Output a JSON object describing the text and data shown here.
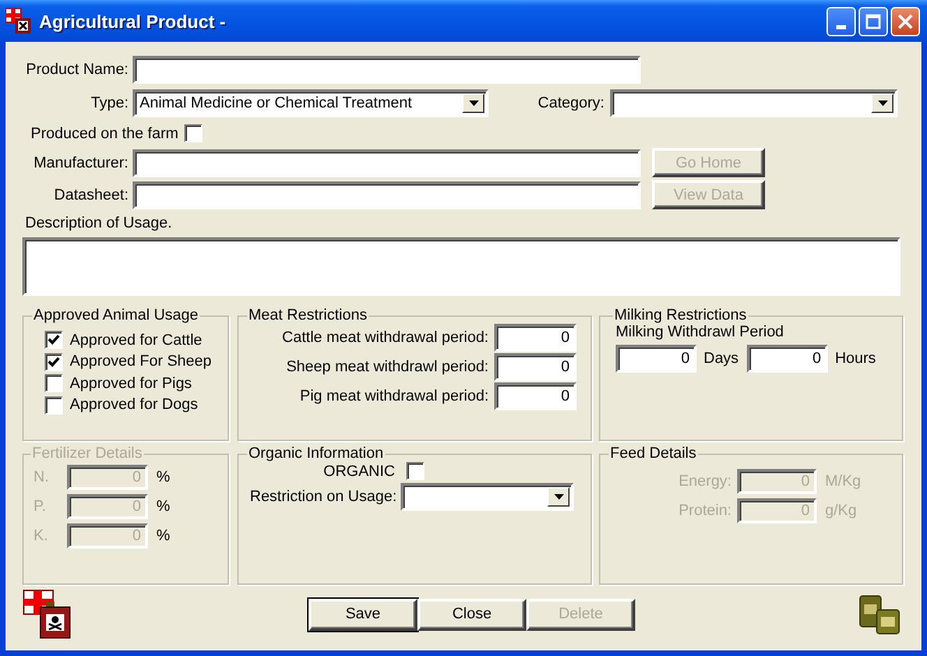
{
  "window": {
    "title": "Agricultural Product -"
  },
  "product_name": {
    "label": "Product Name:"
  },
  "type": {
    "label": "Type:",
    "value": "Animal Medicine or Chemical Treatment"
  },
  "category": {
    "label": "Category:"
  },
  "produced_on_farm": {
    "label": "Produced on the farm",
    "checked": false
  },
  "manufacturer": {
    "label": "Manufacturer:"
  },
  "datasheet": {
    "label": "Datasheet:"
  },
  "side_buttons": [
    {
      "label": "Go Home",
      "disabled": true
    },
    {
      "label": "View Data",
      "disabled": true
    }
  ],
  "description": {
    "label": "Description of Usage."
  },
  "approved_animal_usage": {
    "title": "Approved Animal Usage",
    "items": [
      {
        "label": "Approved for Cattle",
        "checked": true
      },
      {
        "label": "Approved For Sheep",
        "checked": true
      },
      {
        "label": "Approved for Pigs",
        "checked": false
      },
      {
        "label": "Approved for Dogs",
        "checked": false
      }
    ]
  },
  "meat_restrictions": {
    "title": "Meat Restrictions",
    "rows": [
      {
        "label": "Cattle meat withdrawal period:",
        "value": "0"
      },
      {
        "label": "Sheep meat withdrawl period:",
        "value": "0"
      },
      {
        "label": "Pig meat withdrawal period:",
        "value": "0"
      }
    ]
  },
  "milking_restrictions": {
    "title": "Milking Restrictions",
    "subtitle": "Milking Withdrawl Period",
    "fields": [
      {
        "value": "0",
        "unit": "Days"
      },
      {
        "value": "0",
        "unit": "Hours"
      }
    ]
  },
  "fertilizer_details": {
    "title": "Fertilizer Details",
    "disabled": true,
    "rows": [
      {
        "label": "N.",
        "value": "0",
        "unit": "%",
        "disabled": true,
        "unit_disabled": false
      },
      {
        "label": "P.",
        "value": "0",
        "unit": "%",
        "disabled": true,
        "unit_disabled": false
      },
      {
        "label": "K.",
        "value": "0",
        "unit": "%",
        "disabled": true,
        "unit_disabled": false
      }
    ]
  },
  "organic_information": {
    "title": "Organic Information",
    "organic": {
      "label": "ORGANIC",
      "checked": false
    },
    "restriction": {
      "label": "Restriction on Usage:"
    }
  },
  "feed_details": {
    "title": "Feed Details",
    "rows": [
      {
        "label": "Energy:",
        "value": "0",
        "unit": "M/Kg",
        "disabled": true,
        "unit_disabled": true
      },
      {
        "label": "Protein:",
        "value": "0",
        "unit": "g/Kg",
        "disabled": true,
        "unit_disabled": true
      }
    ]
  },
  "buttons": [
    {
      "label": "Save",
      "default": true,
      "disabled": false
    },
    {
      "label": "Close",
      "default": false,
      "disabled": false
    },
    {
      "label": "Delete",
      "default": false,
      "disabled": true
    }
  ]
}
